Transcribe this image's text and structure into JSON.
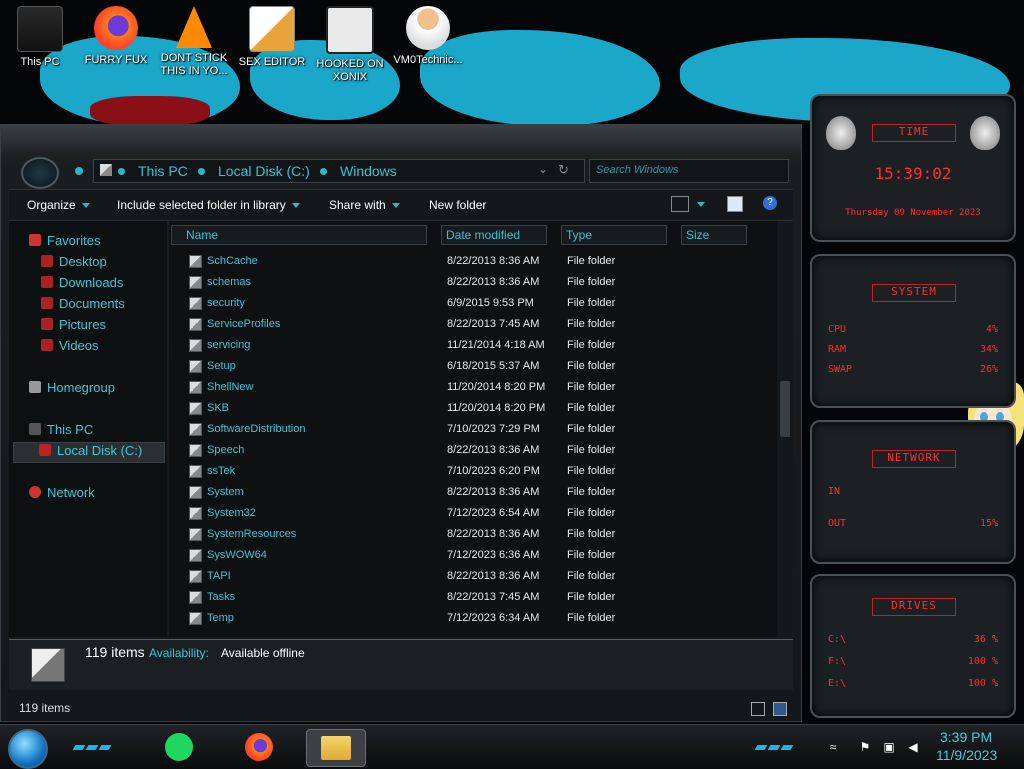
{
  "desktop": {
    "icons": [
      {
        "label": "This PC"
      },
      {
        "label": "FURRY FUX"
      },
      {
        "label": "DONT STICK THIS IN YO..."
      },
      {
        "label": "SEX EDITOR"
      },
      {
        "label": "HOOKED ON XONIX"
      },
      {
        "label": "VM0Technic..."
      }
    ]
  },
  "explorer": {
    "breadcrumb": [
      "This PC",
      "Local Disk (C:)",
      "Windows"
    ],
    "search_placeholder": "Search Windows",
    "toolbar": {
      "organize": "Organize",
      "include_library": "Include selected folder in library",
      "share_with": "Share with",
      "new_folder": "New folder"
    },
    "nav": {
      "favorites": "Favorites",
      "desktop": "Desktop",
      "downloads": "Downloads",
      "documents": "Documents",
      "pictures": "Pictures",
      "videos": "Videos",
      "homegroup": "Homegroup",
      "this_pc": "This PC",
      "local_disk": "Local Disk (C:)",
      "network": "Network"
    },
    "columns": {
      "name": "Name",
      "date": "Date modified",
      "type": "Type",
      "size": "Size"
    },
    "files": [
      {
        "name": "SchCache",
        "date": "8/22/2013 8:36 AM",
        "type": "File folder"
      },
      {
        "name": "schemas",
        "date": "8/22/2013 8:36 AM",
        "type": "File folder"
      },
      {
        "name": "security",
        "date": "6/9/2015 9:53 PM",
        "type": "File folder"
      },
      {
        "name": "ServiceProfiles",
        "date": "8/22/2013 7:45 AM",
        "type": "File folder"
      },
      {
        "name": "servicing",
        "date": "11/21/2014 4:18 AM",
        "type": "File folder"
      },
      {
        "name": "Setup",
        "date": "6/18/2015 5:37 AM",
        "type": "File folder"
      },
      {
        "name": "ShellNew",
        "date": "11/20/2014 8:20 PM",
        "type": "File folder"
      },
      {
        "name": "SKB",
        "date": "11/20/2014 8:20 PM",
        "type": "File folder"
      },
      {
        "name": "SoftwareDistribution",
        "date": "7/10/2023 7:29 PM",
        "type": "File folder"
      },
      {
        "name": "Speech",
        "date": "8/22/2013 8:36 AM",
        "type": "File folder"
      },
      {
        "name": "ssTek",
        "date": "7/10/2023 6:20 PM",
        "type": "File folder"
      },
      {
        "name": "System",
        "date": "8/22/2013 8:36 AM",
        "type": "File folder"
      },
      {
        "name": "System32",
        "date": "7/12/2023 6:54 AM",
        "type": "File folder"
      },
      {
        "name": "SystemResources",
        "date": "8/22/2013 8:36 AM",
        "type": "File folder"
      },
      {
        "name": "SysWOW64",
        "date": "7/12/2023 6:36 AM",
        "type": "File folder"
      },
      {
        "name": "TAPI",
        "date": "8/22/2013 8:36 AM",
        "type": "File folder"
      },
      {
        "name": "Tasks",
        "date": "8/22/2013 7:45 AM",
        "type": "File folder"
      },
      {
        "name": "Temp",
        "date": "7/12/2023 6:34 AM",
        "type": "File folder"
      }
    ],
    "details": {
      "count": "119 items",
      "availability_label": "Availability:",
      "availability_value": "Available offline"
    },
    "status": "119 items"
  },
  "gadgets": {
    "time": {
      "title": "TIME",
      "clock": "15:39:02",
      "date": "Thursday 09 November 2023"
    },
    "system": {
      "title": "SYSTEM",
      "cpu_label": "CPU",
      "cpu": "4%",
      "ram_label": "RAM",
      "ram": "34%",
      "swap_label": "SWAP",
      "swap": "26%"
    },
    "network": {
      "title": "NETWORK",
      "in_label": "IN",
      "out_label": "OUT",
      "out": "15%"
    },
    "drives": {
      "title": "DRIVES",
      "items": [
        {
          "label": "C:\\",
          "value": "36 %"
        },
        {
          "label": "F:\\",
          "value": "100 %"
        },
        {
          "label": "E:\\",
          "value": "100 %"
        }
      ]
    }
  },
  "taskbar": {
    "time": "3:39 PM",
    "date": "11/9/2023"
  },
  "colors": {
    "accent": "#38c8da",
    "gadget_red": "#ff2c36",
    "wallpaper_paint": "#1aa7c9"
  }
}
